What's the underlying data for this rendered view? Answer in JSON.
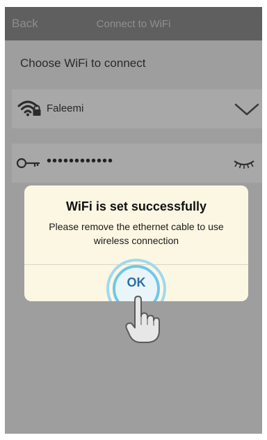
{
  "navbar": {
    "back_label": "Back",
    "title": "Connect to WiFi"
  },
  "form": {
    "choose_label": "Choose WiFi to connect",
    "wifi_name": "Faleemi",
    "password_mask": "••••••••••••",
    "icons": {
      "wifi": "wifi-lock-icon",
      "dropdown": "chevron-down-icon",
      "key": "key-icon",
      "visibility": "eye-closed-icon"
    }
  },
  "dialog": {
    "title": "WiFi is set successfully",
    "message": "Please remove the ethernet cable to use wireless connection",
    "ok_label": "OK"
  },
  "overlay": {
    "pointer": "tap-hand-icon",
    "ring_color": "#6ec7ea"
  }
}
